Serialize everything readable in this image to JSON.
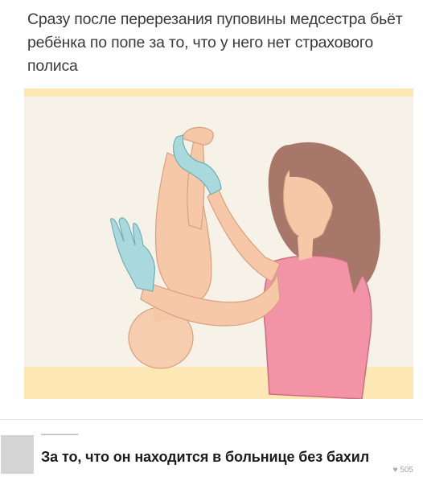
{
  "post": {
    "text": "Сразу после перерезания пуповины медсестра бьёт ребёнка по попе за то, что у него нет страхового полиса"
  },
  "comment": {
    "text": "За то, что он находится в больнице без бахил",
    "likes": "505"
  },
  "icons": {
    "like": "heart-icon"
  },
  "colors": {
    "illustration_bg": "#f7f2e8",
    "glove": "#a9d9dd",
    "skin": "#f6c8a8",
    "hair": "#a7786a",
    "shirt": "#f294a6"
  }
}
